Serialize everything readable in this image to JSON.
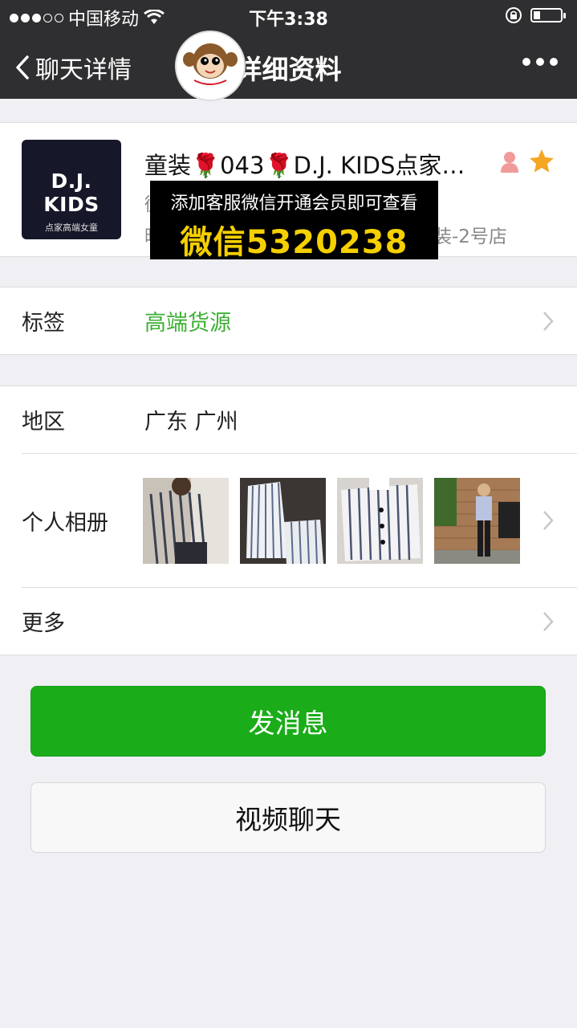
{
  "status": {
    "carrier": "中国移动",
    "time": "下午3:38",
    "signal_bars_filled": 3,
    "signal_bars_total": 5
  },
  "nav": {
    "back_label": "聊天详情",
    "title": "详细资料",
    "more_icon": "more-icon"
  },
  "profile": {
    "avatar_brand": "D.J. KIDS",
    "avatar_sub": "点家高端女童",
    "name": "童装🌹043🌹D.J. KIDS点家…",
    "line2_prefix": "微",
    "line3_prefix": "昵",
    "line3_suffix": "装-2号店"
  },
  "overlay": {
    "line1": "添加客服微信开通会员即可查看",
    "line2": "微信5320238"
  },
  "rows": {
    "tag_label": "标签",
    "tag_value": "高端货源",
    "region_label": "地区",
    "region_value": "广东  广州",
    "album_label": "个人相册",
    "more_label": "更多"
  },
  "buttons": {
    "send_message": "发消息",
    "video_call": "视频聊天"
  },
  "colors": {
    "nav_bg": "#2f2f31",
    "accent_green": "#1aad19",
    "tag_green": "#3cb034",
    "star": "#f5a623",
    "overlay_text": "#f5d000"
  }
}
